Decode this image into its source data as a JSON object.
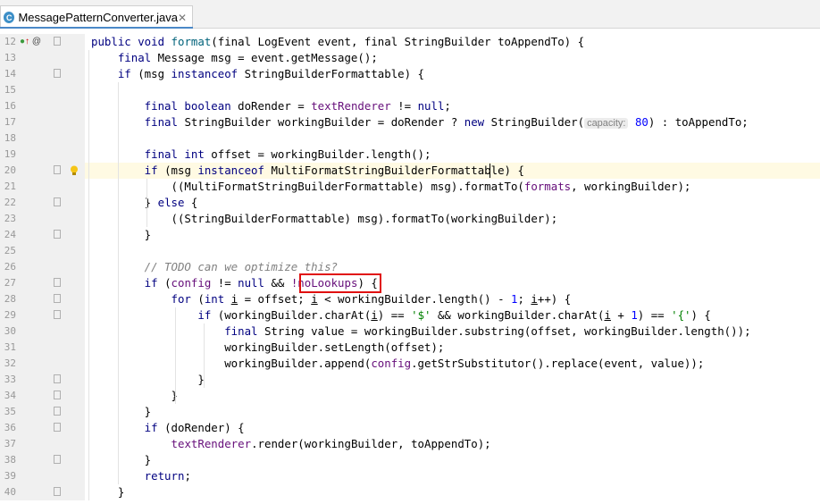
{
  "tab": {
    "title": "MessagePatternConverter.java",
    "icon": "java-class-icon",
    "close_glyph": "✕"
  },
  "gutter_icons": {
    "line12": "override-implement-icon",
    "line20": "intention-bulb-icon",
    "at": "@"
  },
  "line_numbers": [
    "12",
    "13",
    "14",
    "15",
    "16",
    "17",
    "18",
    "19",
    "20",
    "21",
    "22",
    "23",
    "24",
    "25",
    "26",
    "27",
    "28",
    "29",
    "30",
    "31",
    "32",
    "33",
    "34",
    "35",
    "36",
    "37",
    "38",
    "39",
    "40"
  ],
  "code": {
    "l12": {
      "a": "public void ",
      "b": "format",
      "c": "(final LogEvent event, final StringBuilder toAppendTo) {"
    },
    "l13": {
      "a": "    final",
      "b": " Message msg = event.getMessage();"
    },
    "l14": {
      "a": "    if",
      "b": " (msg ",
      "c": "instanceof",
      "d": " StringBuilderFormattable) {"
    },
    "l15": "",
    "l16": {
      "a": "        final boolean",
      "b": " doRender = ",
      "c": "textRenderer",
      "d": " != ",
      "e": "null",
      "f": ";"
    },
    "l17": {
      "a": "        final",
      "b": " StringBuilder workingBuilder = doRender ? ",
      "c": "new",
      "d": " StringBuilder(",
      "hint": "capacity:",
      "e": " 80",
      "f": ") : toAppendTo;"
    },
    "l18": "",
    "l19": {
      "a": "        final int",
      "b": " offset = workingBuilder.length();"
    },
    "l20": {
      "a": "        if",
      "b": " (msg ",
      "c": "instanceof",
      "d": " MultiFormatStringBuilderFormattable) {"
    },
    "l21": {
      "a": "            ((MultiFormatStringBuilderFormattable) msg).formatTo(",
      "b": "formats",
      "c": ", workingBuilder);"
    },
    "l22": {
      "a": "        } ",
      "b": "else",
      "c": " {"
    },
    "l23": {
      "a": "            ((StringBuilderFormattable) msg).formatTo(workingBuilder);"
    },
    "l24": {
      "a": "        }"
    },
    "l25": "",
    "l26": {
      "a": "        // TODO can we optimize this?"
    },
    "l27": {
      "a": "        if",
      "b": " (",
      "c": "config",
      "d": " != ",
      "e": "null",
      "f": " && ",
      "g": "!noLookups",
      "h": ") {"
    },
    "l28": {
      "a": "            for",
      "b": " (",
      "c": "int",
      "d": " ",
      "e": "i",
      "f": " = offset; ",
      "g": "i",
      "h": " < workingBuilder.length() - ",
      "i": "1",
      "j": "; ",
      "k": "i",
      "l": "++) {"
    },
    "l29": {
      "a": "                if",
      "b": " (workingBuilder.charAt(",
      "c": "i",
      "d": ") == ",
      "e": "'$'",
      "f": " && workingBuilder.charAt(",
      "g": "i",
      "h": " + ",
      "i": "1",
      "j": ") == ",
      "k": "'{'",
      "l": ") {"
    },
    "l30": {
      "a": "                    final",
      "b": " String value = workingBuilder.substring(offset, workingBuilder.length());"
    },
    "l31": {
      "a": "                    workingBuilder.setLength(offset);"
    },
    "l32": {
      "a": "                    workingBuilder.append(",
      "b": "config",
      "c": ".getStrSubstitutor().replace(event, value));"
    },
    "l33": {
      "a": "                }"
    },
    "l34": {
      "a": "            }"
    },
    "l35": {
      "a": "        }"
    },
    "l36": {
      "a": "        if",
      "b": " (doRender) {"
    },
    "l37": {
      "a": "            ",
      "b": "textRenderer",
      "c": ".render(workingBuilder, toAppendTo);"
    },
    "l38": {
      "a": "        }"
    },
    "l39": {
      "a": "        return",
      "b": ";"
    },
    "l40": {
      "a": "    }"
    }
  },
  "colors": {
    "keyword": "#000080",
    "field": "#660e7a",
    "comment": "#808080",
    "number": "#0000ff",
    "string": "#008000",
    "highlight_box": "#e01010"
  }
}
